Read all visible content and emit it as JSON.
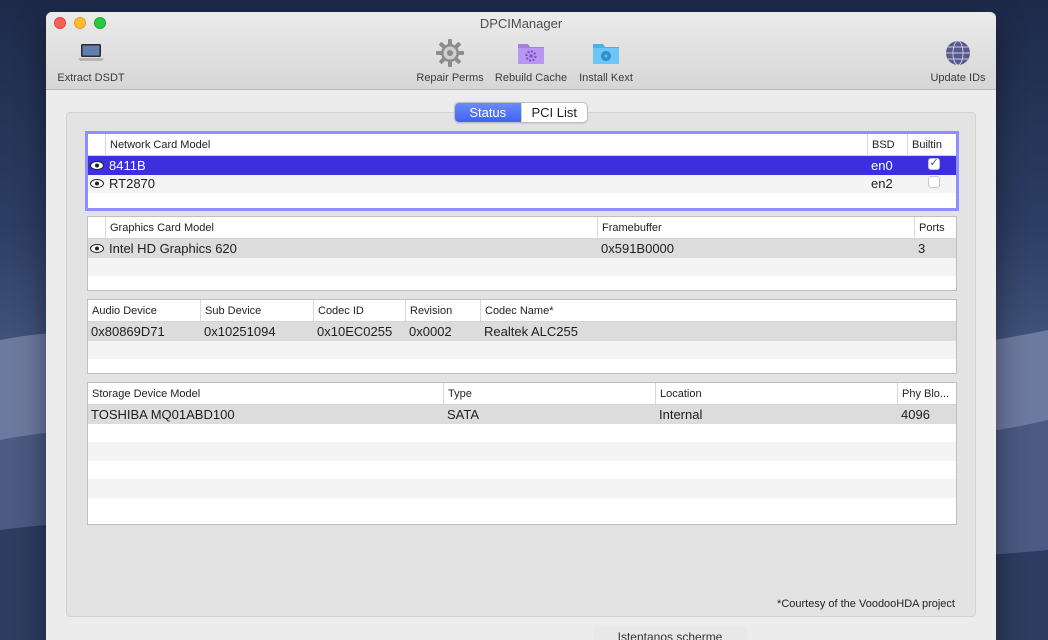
{
  "window": {
    "title": "DPCIManager"
  },
  "toolbar": {
    "extract_dsdt": "Extract DSDT",
    "repair_perms": "Repair Perms",
    "rebuild_cache": "Rebuild Cache",
    "install_kext": "Install Kext",
    "update_ids": "Update IDs"
  },
  "tabs": {
    "status": "Status",
    "pci_list": "PCI List"
  },
  "network": {
    "headers": [
      "Network Card Model",
      "BSD",
      "Builtin"
    ],
    "rows": [
      {
        "model": "8411B",
        "bsd": "en0",
        "builtin": true
      },
      {
        "model": "RT2870",
        "bsd": "en2",
        "builtin": false
      }
    ]
  },
  "graphics": {
    "headers": [
      "Graphics Card Model",
      "Framebuffer",
      "Ports"
    ],
    "rows": [
      {
        "model": "Intel HD Graphics 620",
        "framebuffer": "0x591B0000",
        "ports": "3"
      }
    ]
  },
  "audio": {
    "headers": [
      "Audio Device",
      "Sub Device",
      "Codec ID",
      "Revision",
      "Codec Name*"
    ],
    "rows": [
      {
        "device": "0x80869D71",
        "sub": "0x10251094",
        "codec": "0x10EC0255",
        "rev": "0x0002",
        "name": "Realtek ALC255"
      }
    ]
  },
  "storage": {
    "headers": [
      "Storage Device Model",
      "Type",
      "Location",
      "Phy Blo..."
    ],
    "rows": [
      {
        "model": "TOSHIBA MQ01ABD100",
        "type": "SATA",
        "location": "Internal",
        "phy": "4096"
      }
    ]
  },
  "footnote": "*Courtesy of the VoodooHDA project",
  "dock_hint": "Istentanos scherme"
}
